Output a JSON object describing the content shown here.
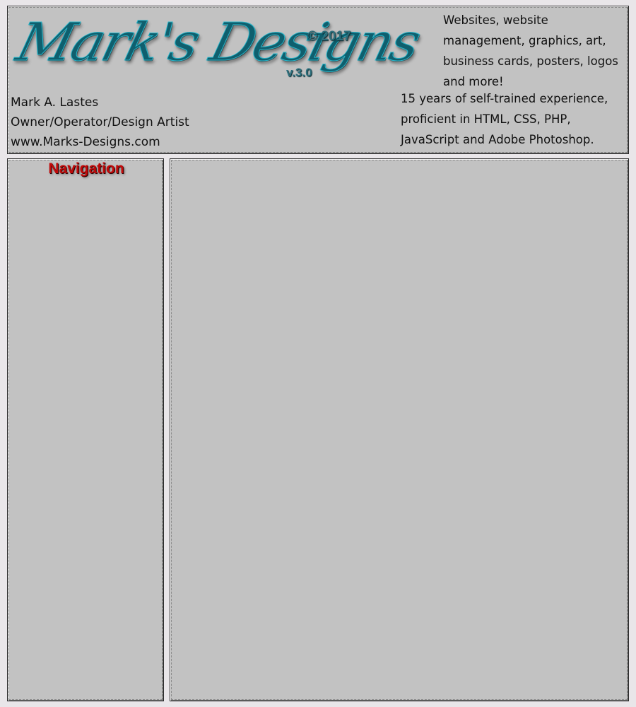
{
  "header": {
    "logo_text": "Mark's Designs",
    "copyright": "© 2017",
    "version": "v.3.0",
    "owner_name": "Mark A. Lastes",
    "owner_role": "Owner/Operator/Design Artist",
    "owner_site": "www.Marks-Designs.com",
    "services_text": "Websites, website management, graphics, art, business cards, posters, logos and more!",
    "experience_text": "15 years of self-trained experience, proficient in HTML, CSS, PHP, JavaScript and Adobe Photoshop."
  },
  "nav": {
    "title": "Navigation"
  },
  "colors": {
    "page_background": "#e9e6e9",
    "panel_background": "#c2c2c2",
    "logo_teal": "#27b4c8",
    "nav_title_red": "#c10a0a"
  }
}
